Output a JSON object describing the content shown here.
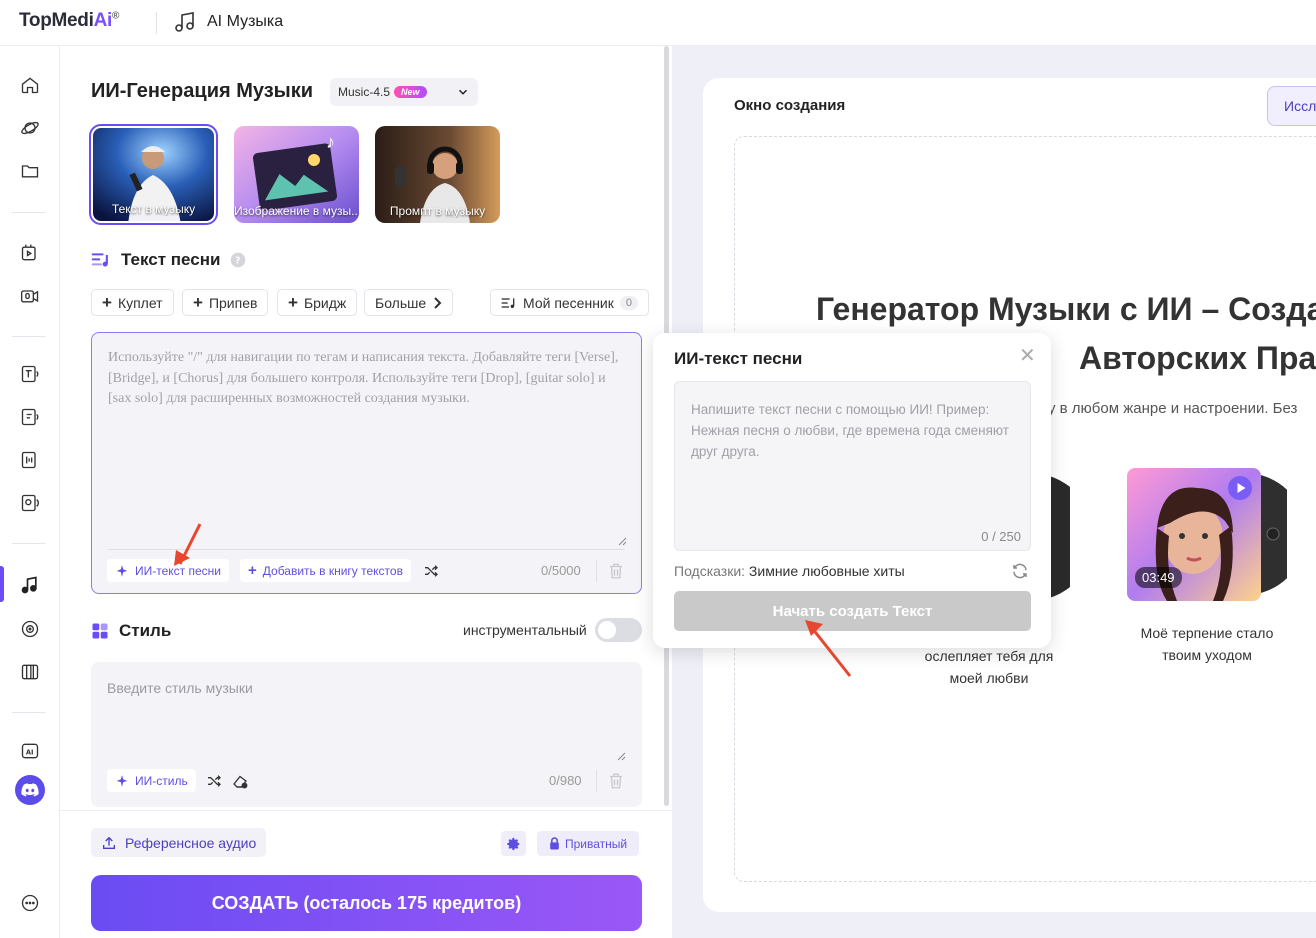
{
  "header": {
    "logo_main": "TopMedi",
    "logo_ai": "Ai",
    "logo_reg": "®",
    "app_title": "AI Музыка"
  },
  "sidebar": {
    "items": [
      "home-icon",
      "planet-icon",
      "folder-icon",
      "video-audio-icon",
      "video-mic-icon",
      "text-speech-icon",
      "speech-icon",
      "voice-convert-icon",
      "voice-clone-icon",
      "music-note-icon",
      "vinyl-icon",
      "piano-icon",
      "ai-chip-icon"
    ],
    "active_item": "music-note-icon"
  },
  "main": {
    "title": "ИИ-Генерация Музыки",
    "model": {
      "label": "Music-4.5",
      "badge": "New"
    },
    "modes": [
      {
        "label": "Текст в музыку",
        "selected": true
      },
      {
        "label": "Изображение в музы..."
      },
      {
        "label": "Промпт в музыку"
      }
    ],
    "lyrics_section": {
      "title": "Текст песни",
      "tags": [
        "Куплет",
        "Припев",
        "Бридж"
      ],
      "more_label": "Больше",
      "songbook_label": "Мой песенник",
      "songbook_count": "0",
      "placeholder": "Используйте \"/\" для навигации по тегам и написания текста. Добавляйте теги [Verse], [Bridge], и [Chorus] для большего контроля. Используйте теги [Drop], [guitar solo] и [sax solo] для расширенных возможностей создания музыки.",
      "ai_lyrics_label": "ИИ-текст песни",
      "add_book_label": "Добавить в книгу текстов",
      "counter": "0/5000"
    },
    "style_section": {
      "title": "Стиль",
      "instrumental_label": "инструментальный",
      "placeholder": "Введите стиль музыки",
      "ai_style_label": "ИИ-стиль",
      "counter": "0/980"
    },
    "bottom": {
      "reference_label": "Референсное аудио",
      "private_label": "Приватный",
      "create_label": "СОЗДАТЬ (осталось 175 кредитов)"
    }
  },
  "right": {
    "title": "Окно создания",
    "research_label": "Иссл",
    "hero_line1": "Генератор Музыки с ИИ – Созда",
    "hero_line2": "Авторских Пра",
    "hero_sub": "у в любом жанре и настроении. Без",
    "song_a_line1": "ослепляет тебя для",
    "song_a_line2": "моей любви",
    "song_b_time": "03:49",
    "song_b_line1": "Моё терпение стало",
    "song_b_line2": "твоим уходом"
  },
  "popup": {
    "title": "ИИ-текст песни",
    "placeholder": "Напишите текст песни с помощью ИИ! Пример: Нежная песня о любви, где времена года сменяют друг друга.",
    "counter": "0 / 250",
    "hint_key": "Подсказки:",
    "hint_value": "Зимние любовные хиты",
    "start_label": "Начать создать Текст"
  },
  "colors": {
    "accent": "#6b4cf6",
    "accent2": "#9b57f7",
    "annotation_arrow": "#e8472f",
    "disabled": "#c9c9c9"
  }
}
